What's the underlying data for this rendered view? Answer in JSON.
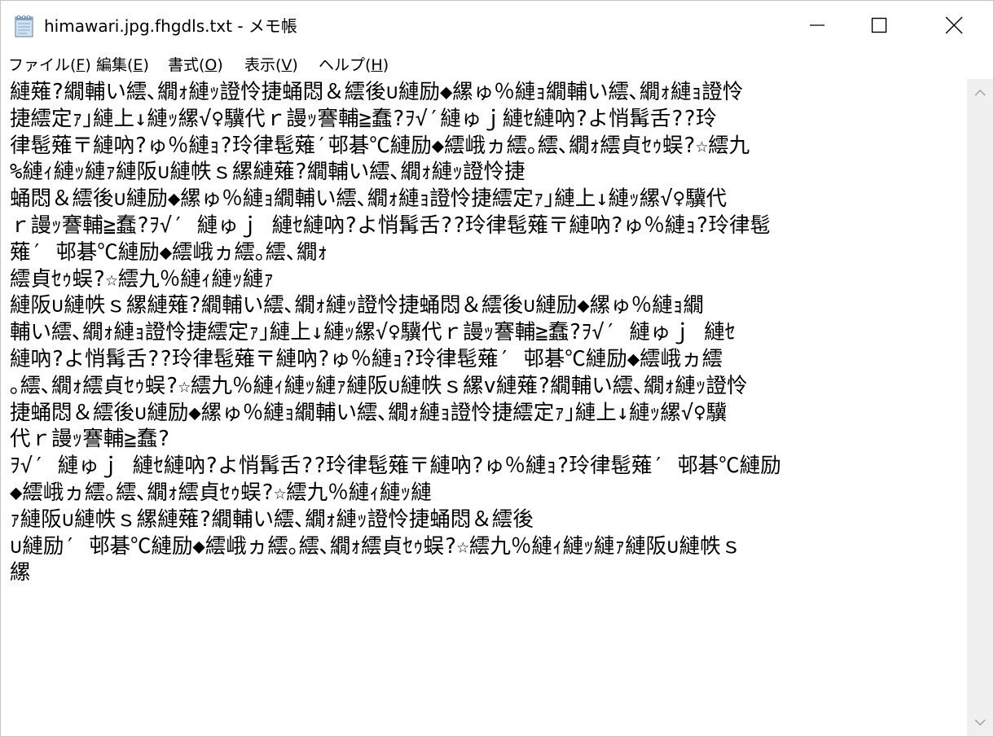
{
  "window": {
    "title": "himawari.jpg.fhgdls.txt - メモ帳"
  },
  "menu": {
    "items": [
      {
        "label": "ファイル(",
        "accel": "F",
        "close": ")"
      },
      {
        "label": "編集(",
        "accel": "E",
        "close": ")"
      },
      {
        "label": "書式(",
        "accel": "O",
        "close": ")"
      },
      {
        "label": "表示(",
        "accel": "V",
        "close": ")"
      },
      {
        "label": "ヘルプ(",
        "accel": "H",
        "close": ")"
      }
    ]
  },
  "editor": {
    "content": "縺薙?繝輔い繧､繝ｫ縺ｯ證怜捷蛹悶＆繧後∪縺励◆縲ゅ％縺ｮ繝輔い繧､繝ｫ縺ｮ證怜\n捷繧定ｧ｣縺上↓縺ｯ縲√♀驥代ｒ謾ｯ謇輔≧蠢?ｦ√′縺ゅｊ縺ｾ縺吶?よ悄髯舌??玲\n律髢薙〒縺吶?ゅ％縺ｮ?玲律髢薙′邨碁℃縺励◆繧峨ヵ繧｡繧､繝ｫ繧貞ｾｩ蜈?☆繧九\n%縺ｨ縺ｯ縺ｧ縺阪∪縺帙ｓ縲縺薙?繝輔い繧､繝ｫ縺ｯ證怜捷\n蛹悶＆繧後∪縺励◆縲ゅ％縺ｮ繝輔い繧､繝ｫ縺ｮ證怜捷繧定ｧ｣縺上↓縺ｯ縲√♀驥代\nｒ謾ｯ謇輔≧蠢?ｦ√′ 縺ゅｊ 縺ｾ縺吶?よ悄髯舌??玲律髢薙〒縺吶?ゅ％縺ｮ?玲律髢\n薙′ 邨碁℃縺励◆繧峨ヵ繧｡繧､繝ｫ\n繧貞ｾｩ蜈?☆繧九％縺ｨ縺ｯ縺ｧ\n縺阪∪縺帙ｓ縲縺薙?繝輔い繧､繝ｫ縺ｯ證怜捷蛹悶＆繧後∪縺励◆縲ゅ％縺ｮ繝\n輔い繧､繝ｫ縺ｮ證怜捷繧定ｧ｣縺上↓縺ｯ縲√♀驥代ｒ謾ｯ謇輔≧蠢?ｦ√′ 縺ゅｊ 縺ｾ\n縺吶?よ悄髯舌??玲律髢薙〒縺吶?ゅ％縺ｮ?玲律髢薙′ 邨碁℃縺励◆繧峨ヵ繧\n｡繧､繝ｫ繧貞ｾｩ蜈?☆繧九％縺ｨ縺ｯ縺ｧ縺阪∪縺帙ｓ縲v縺薙?繝輔い繧､繝ｫ縺ｯ證怜\n捷蛹悶＆繧後∪縺励◆縲ゅ％縺ｮ繝輔い繧､繝ｫ縺ｮ證怜捷繧定ｧ｣縺上↓縺ｯ縲√♀驥\n代ｒ謾ｯ謇輔≧蠢?\nｦ√′ 縺ゅｊ 縺ｾ縺吶?よ悄髯舌??玲律髢薙〒縺吶?ゅ％縺ｮ?玲律髢薙′ 邨碁℃縺励\n◆繧峨ヵ繧｡繧､繝ｫ繧貞ｾｩ蜈?☆繧九％縺ｨ縺ｯ縺\nｧ縺阪∪縺帙ｓ縲縺薙?繝輔い繧､繝ｫ縺ｯ證怜捷蛹悶＆繧後\n∪縺励′ 邨碁℃縺励◆繧峨ヵ繧｡繧､繝ｫ繧貞ｾｩ蜈?☆繧九％縺ｨ縺ｯ縺ｧ縺阪∪縺帙ｓ\n縲"
  }
}
